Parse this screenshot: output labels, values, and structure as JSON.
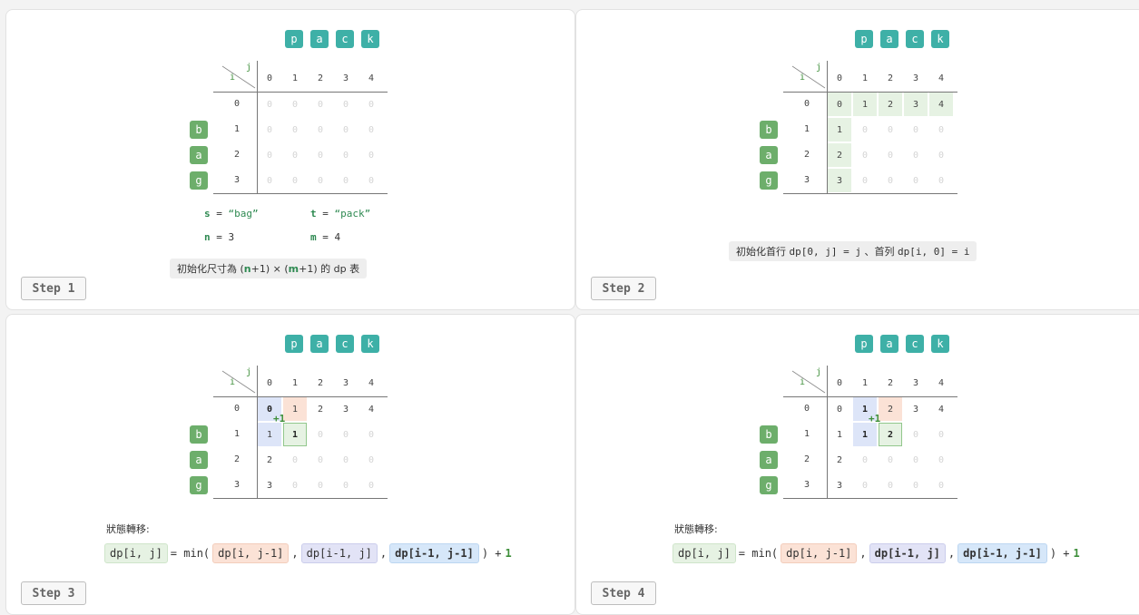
{
  "t_chars": [
    "p",
    "a",
    "c",
    "k"
  ],
  "s_chars": [
    "b",
    "a",
    "g"
  ],
  "col_labels": [
    "0",
    "1",
    "2",
    "3",
    "4"
  ],
  "row_labels": [
    "0",
    "1",
    "2",
    "3"
  ],
  "j_label": "j",
  "i_label": "i",
  "step1": {
    "button": "Step 1",
    "grid": [
      [
        "0",
        "0",
        "0",
        "0",
        "0"
      ],
      [
        "0",
        "0",
        "0",
        "0",
        "0"
      ],
      [
        "0",
        "0",
        "0",
        "0",
        "0"
      ],
      [
        "0",
        "0",
        "0",
        "0",
        "0"
      ]
    ],
    "s_name": "s",
    "s_value": "“bag”",
    "t_name": "t",
    "t_value": "“pack”",
    "n_name": "n",
    "n_value": "3",
    "m_name": "m",
    "m_value": "4",
    "equals": "=",
    "note_prefix": "初始化尺寸為 (",
    "note_n": "n",
    "note_mid1": "+1) × (",
    "note_m": "m",
    "note_mid2": "+1) 的 dp 表"
  },
  "step2": {
    "button": "Step 2",
    "grid": [
      [
        "0",
        "1",
        "2",
        "3",
        "4"
      ],
      [
        "1",
        "0",
        "0",
        "0",
        "0"
      ],
      [
        "2",
        "0",
        "0",
        "0",
        "0"
      ],
      [
        "3",
        "0",
        "0",
        "0",
        "0"
      ]
    ],
    "note_a": "初始化首行 ",
    "note_code1": "dp[0, j] = j",
    "note_b": " 、首列 ",
    "note_code2": "dp[i, 0] = i"
  },
  "step3": {
    "button": "Step 3",
    "grid": [
      [
        "0",
        "1",
        "2",
        "3",
        "4"
      ],
      [
        "1",
        "1",
        "0",
        "0",
        "0"
      ],
      [
        "2",
        "0",
        "0",
        "0",
        "0"
      ],
      [
        "3",
        "0",
        "0",
        "0",
        "0"
      ]
    ],
    "plus": "+1",
    "trans_label": "狀態轉移:",
    "f_lhs": "dp[i, j]",
    "f_eq": "= min(",
    "f_a": "dp[i, j-1]",
    "f_comma": ",",
    "f_b": "dp[i-1, j]",
    "f_c": "dp[i-1, j-1]",
    "f_close": ") +",
    "f_one": "1"
  },
  "step4": {
    "button": "Step 4",
    "grid": [
      [
        "0",
        "1",
        "2",
        "3",
        "4"
      ],
      [
        "1",
        "1",
        "2",
        "0",
        "0"
      ],
      [
        "2",
        "0",
        "0",
        "0",
        "0"
      ],
      [
        "3",
        "0",
        "0",
        "0",
        "0"
      ]
    ],
    "plus": "+1",
    "trans_label": "狀態轉移:",
    "f_lhs": "dp[i, j]",
    "f_eq": "= min(",
    "f_a": "dp[i, j-1]",
    "f_comma": ",",
    "f_b": "dp[i-1, j]",
    "f_c": "dp[i-1, j-1]",
    "f_close": ") +",
    "f_one": "1"
  }
}
